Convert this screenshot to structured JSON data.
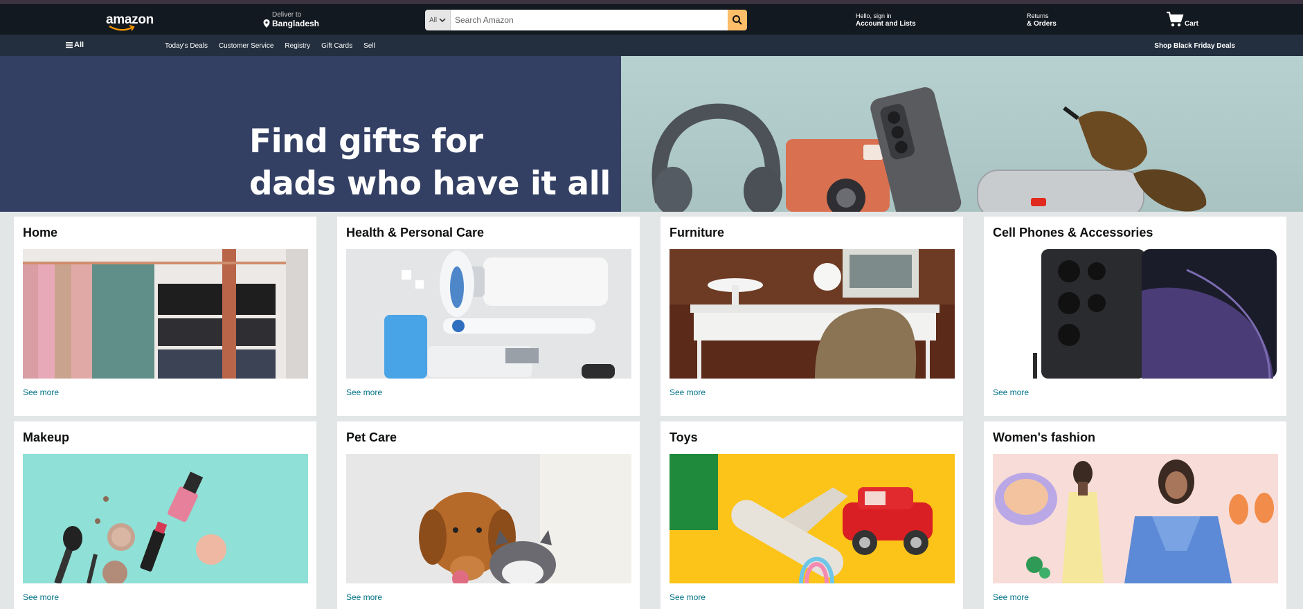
{
  "header": {
    "logo_text": "amazon",
    "deliver_line1": "Deliver to",
    "deliver_line2": "Bangladesh",
    "search_category": "All",
    "search_placeholder": "Search Amazon",
    "account_line1": "Hello, sign in",
    "account_line2": "Account and Lists",
    "returns_line1": "Returns",
    "returns_line2": "& Orders",
    "cart_label": "Cart",
    "accent_color": "#febd69"
  },
  "subnav": {
    "all_label": "All",
    "links": [
      "Today's Deals",
      "Customer Service",
      "Registry",
      "Gift Cards",
      "Sell"
    ],
    "promo": "Shop Black Friday Deals"
  },
  "hero": {
    "title": "Find gifts for\ndads who have it all"
  },
  "cards": [
    {
      "title": "Home",
      "link": "See more"
    },
    {
      "title": "Health & Personal Care",
      "link": "See more"
    },
    {
      "title": "Furniture",
      "link": "See more"
    },
    {
      "title": "Cell Phones & Accessories",
      "link": "See more"
    },
    {
      "title": "Makeup",
      "link": "See more"
    },
    {
      "title": "Pet Care",
      "link": "See more"
    },
    {
      "title": "Toys",
      "link": "See more"
    },
    {
      "title": "Women's fashion",
      "link": "See more"
    }
  ]
}
